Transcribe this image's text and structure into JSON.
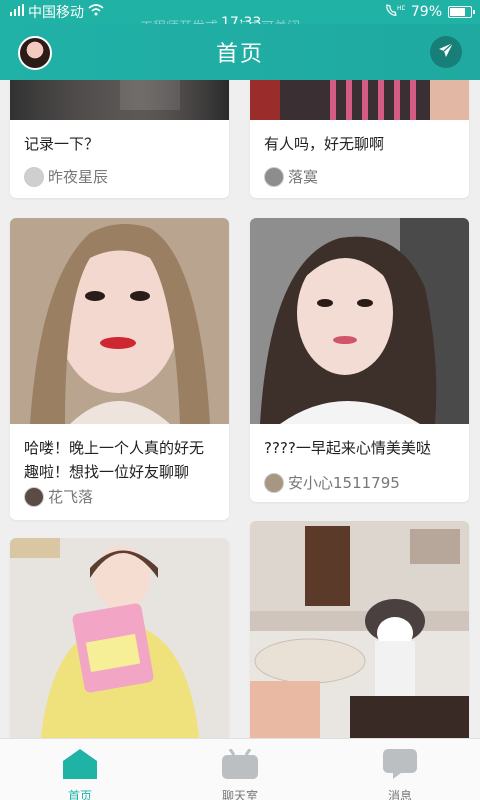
{
  "status_bar": {
    "carrier": "中国移动",
    "notice": "工程师开发或…  点击可关闭",
    "time": "17:33",
    "battery": "79%",
    "battery_level": 0.79
  },
  "header": {
    "title": "首页"
  },
  "feed": {
    "cards": [
      {
        "caption": "记录一下？",
        "author": "昨夜星辰"
      },
      {
        "caption": "有人吗，好无聊啊",
        "author": "落寞"
      },
      {
        "caption": "哈喽！晚上一个人真的好无趣啦！想找一位好友聊聊",
        "author": "花飞落"
      },
      {
        "caption": "????一早起来心情美美哒",
        "author": "安小心1511795"
      },
      {
        "caption": "",
        "author": ""
      },
      {
        "caption": "",
        "author": ""
      }
    ]
  },
  "tabbar": {
    "items": [
      {
        "label": "首页",
        "icon": "home-icon",
        "active": true
      },
      {
        "label": "聊天室",
        "icon": "chatroom-icon",
        "active": false
      },
      {
        "label": "消息",
        "icon": "message-icon",
        "active": false
      }
    ]
  },
  "colors": {
    "accent": "#1fb3a6",
    "header": "#20b1a7"
  }
}
